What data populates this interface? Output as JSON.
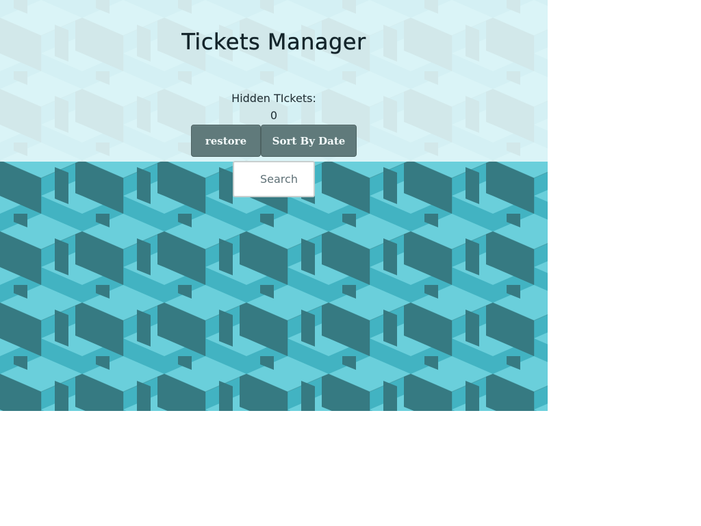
{
  "app": {
    "title": "Tickets Manager"
  },
  "hidden": {
    "label": "Hidden TIckets:",
    "count": "0"
  },
  "toolbar": {
    "restore_label": "restore",
    "sort_label": "Sort By Date"
  },
  "search": {
    "placeholder": "Search",
    "value": ""
  },
  "colors": {
    "cube_top": "#6acfdb",
    "cube_mid": "#42b3c2",
    "cube_dark": "#367a82",
    "button_bg": "#607a7b",
    "title_text": "#14252b"
  }
}
